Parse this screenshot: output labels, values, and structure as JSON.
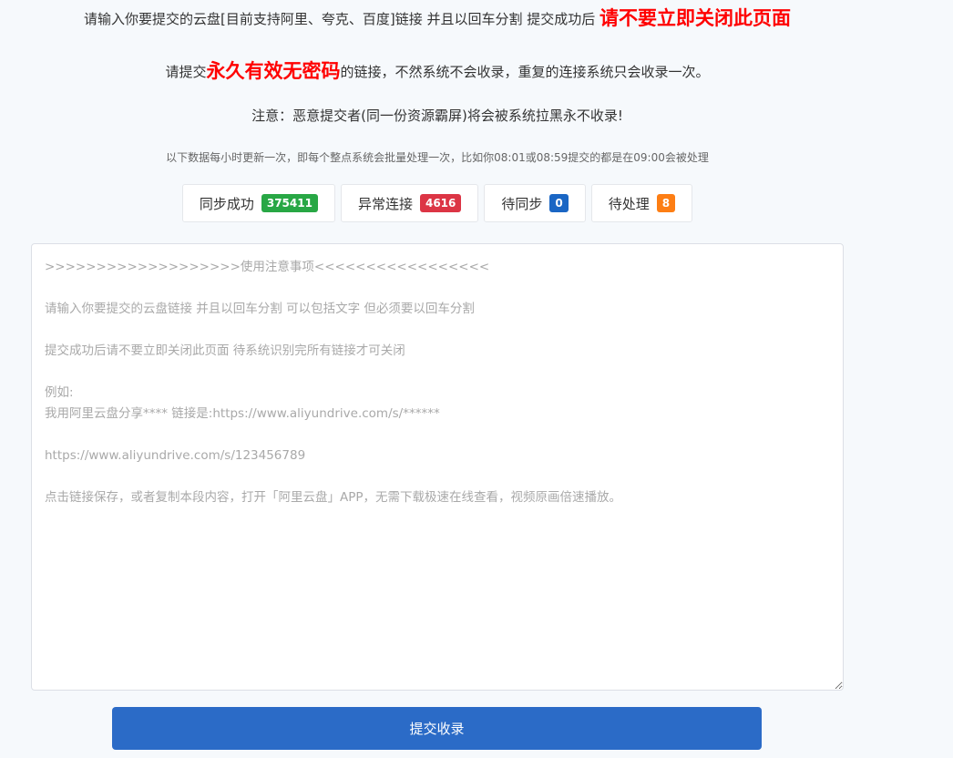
{
  "notice": {
    "line1_text": "请输入你要提交的云盘[目前支持阿里、夸克、百度]链接 并且以回车分割 提交成功后",
    "line1_emphasis": "请不要立即关闭此页面",
    "line2_prefix": "请提交",
    "line2_emphasis": "永久有效无密码",
    "line2_suffix": "的链接，不然系统不会收录，重复的连接系统只会收录一次。",
    "line3_text": "注意：恶意提交者(同一份资源霸屏)将会被系统拉黑永不收录!",
    "line4_text": "以下数据每小时更新一次，即每个整点系统会批量处理一次，比如你08:01或08:59提交的都是在09:00会被处理"
  },
  "stats": [
    {
      "label": "同步成功",
      "value": "375411",
      "color": "#28a745"
    },
    {
      "label": "异常连接",
      "value": "4616",
      "color": "#dc3545"
    },
    {
      "label": "待同步",
      "value": "0",
      "color": "#1a66c4"
    },
    {
      "label": "待处理",
      "value": "8",
      "color": "#fd7e14"
    }
  ],
  "input": {
    "value": "",
    "placeholder": ">>>>>>>>>>>>>>>>>>>使用注意事项<<<<<<<<<<<<<<<<<\n\n请输入你要提交的云盘链接 并且以回车分割 可以包括文字 但必须要以回车分割\n\n提交成功后请不要立即关闭此页面 待系统识别完所有链接才可关闭\n\n例如:\n我用阿里云盘分享**** 链接是:https://www.aliyundrive.com/s/******\n\nhttps://www.aliyundrive.com/s/123456789\n\n点击链接保存，或者复制本段内容，打开「阿里云盘」APP，无需下载极速在线查看，视频原画倍速播放。"
  },
  "submit": {
    "label": "提交收录"
  }
}
